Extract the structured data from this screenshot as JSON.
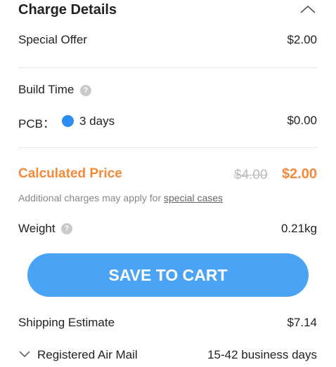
{
  "header": {
    "title": "Charge Details",
    "collapse_icon": "chevron-up-icon"
  },
  "special_offer": {
    "label": "Special Offer",
    "value": "$2.00"
  },
  "build_time": {
    "label": "Build Time",
    "help_icon": "question-icon",
    "help_glyph": "?",
    "pcb_label": "PCB：",
    "selected_option": "3 days",
    "pcb_price": "$0.00",
    "radio_color": "#2d8cf0"
  },
  "calculated_price": {
    "label": "Calculated Price",
    "original_price": "$4.00",
    "discounted_price": "$2.00",
    "accent_color": "#f5893a",
    "note_prefix": "Additional charges may apply for ",
    "note_link": "special cases"
  },
  "weight": {
    "label": "Weight",
    "help_icon": "question-icon",
    "help_glyph": "?",
    "value": "0.21kg"
  },
  "cart_button": {
    "label": "SAVE TO CART",
    "color": "#4aa3f5"
  },
  "shipping": {
    "label": "Shipping Estimate",
    "value": "$7.14",
    "method_icon": "chevron-down-icon",
    "method": "Registered Air Mail",
    "duration": "15-42 business days"
  }
}
